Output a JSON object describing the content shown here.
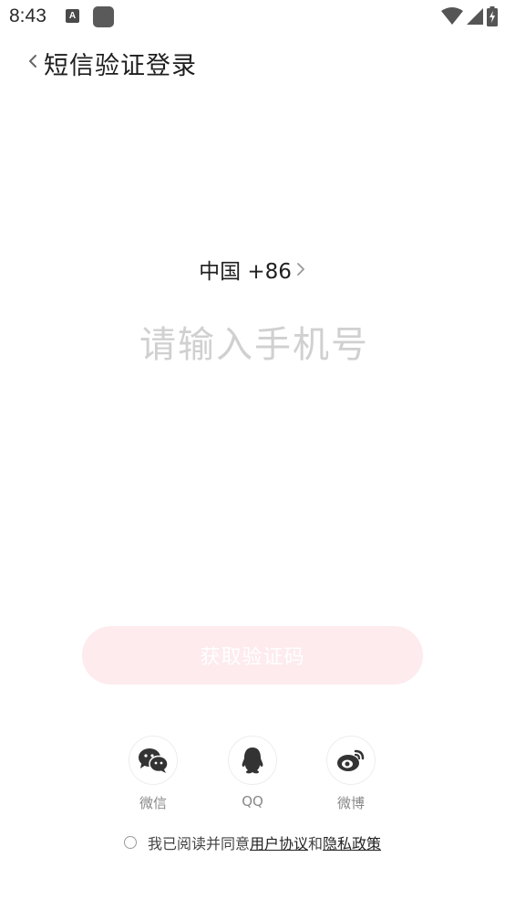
{
  "status_bar": {
    "time": "8:43",
    "a_icon_letter": "A",
    "icons": [
      "a-icon",
      "app-square-icon",
      "wifi-icon",
      "signal-icon",
      "battery-charging-icon"
    ]
  },
  "header": {
    "title": "短信验证登录",
    "back_icon": "chevron-left-icon"
  },
  "country": {
    "label": "中国 +86",
    "chevron_icon": "chevron-right-icon"
  },
  "phone_input": {
    "value": "",
    "placeholder": "请输入手机号"
  },
  "get_code_button": {
    "label": "获取验证码",
    "bg_color": "#fdebee"
  },
  "social": {
    "items": [
      {
        "label": "微信",
        "icon": "wechat-icon"
      },
      {
        "label": "QQ",
        "icon": "qq-icon"
      },
      {
        "label": "微博",
        "icon": "weibo-icon"
      }
    ]
  },
  "agreement": {
    "prefix": "我已阅读并同意",
    "user_agreement": "用户协议",
    "and": "和",
    "privacy_policy": "隐私政策"
  },
  "colors": {
    "text_dark": "#1e1e1e",
    "placeholder": "#d0d0d0",
    "icon_dark": "#333333",
    "label_gray": "#888888"
  }
}
